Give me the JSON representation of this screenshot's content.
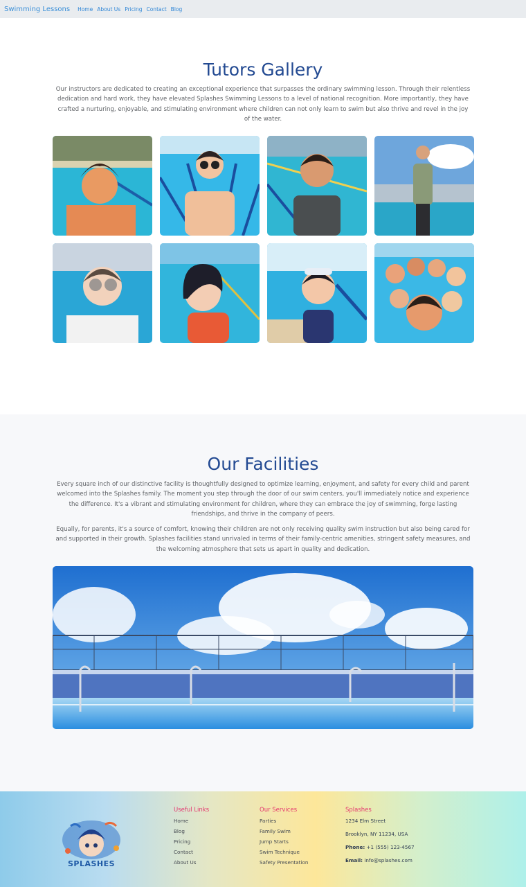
{
  "nav": {
    "brand": "Swimming Lessons",
    "links": [
      "Home",
      "About Us",
      "Pricing",
      "Contact",
      "Blog"
    ]
  },
  "tutors": {
    "title": "Tutors Gallery",
    "description": "Our instructors are dedicated to creating an exceptional experience that surpasses the ordinary swimming lesson. Through their relentless dedication and hard work, they have elevated Splashes Swimming Lessons to a level of national recognition. More importantly, they have crafted a nurturing, enjoyable, and stimulating environment where children can not only learn to swim but also thrive and revel in the joy of the water."
  },
  "facilities": {
    "title": "Our Facilities",
    "paragraph1": "Every square inch of our distinctive facility is thoughtfully designed to optimize learning, enjoyment, and safety for every child and parent welcomed into the Splashes family. The moment you step through the door of our swim centers, you'll immediately notice and experience the difference. It's a vibrant and stimulating environment for children, where they can embrace the joy of swimming, forge lasting friendships, and thrive in the company of peers.",
    "paragraph2": "Equally, for parents, it's a source of comfort, knowing their children are not only receiving quality swim instruction but also being cared for and supported in their growth. Splashes facilities stand unrivaled in terms of their family-centric amenities, stringent safety measures, and the welcoming atmosphere that sets us apart in quality and dedication."
  },
  "footer": {
    "logo_text": "SPLASHES",
    "useful_links": {
      "heading": "Useful Links",
      "items": [
        "Home",
        "Blog",
        "Pricing",
        "Contact",
        "About Us"
      ]
    },
    "services": {
      "heading": "Our Services",
      "items": [
        "Parties",
        "Family Swim",
        "Jump Starts",
        "Swim Technique",
        "Safety Presentation"
      ]
    },
    "contact": {
      "heading": "Splashes",
      "street": "1234 Elm Street",
      "city": "Brooklyn, NY 11234, USA",
      "phone_label": "Phone:",
      "phone": "+1 (555) 123-4567",
      "email_label": "Email:",
      "email": "info@splashes.com"
    }
  },
  "colors": {
    "title": "#234a92",
    "link": "#2f86d6",
    "footer_heading": "#e4366e"
  }
}
